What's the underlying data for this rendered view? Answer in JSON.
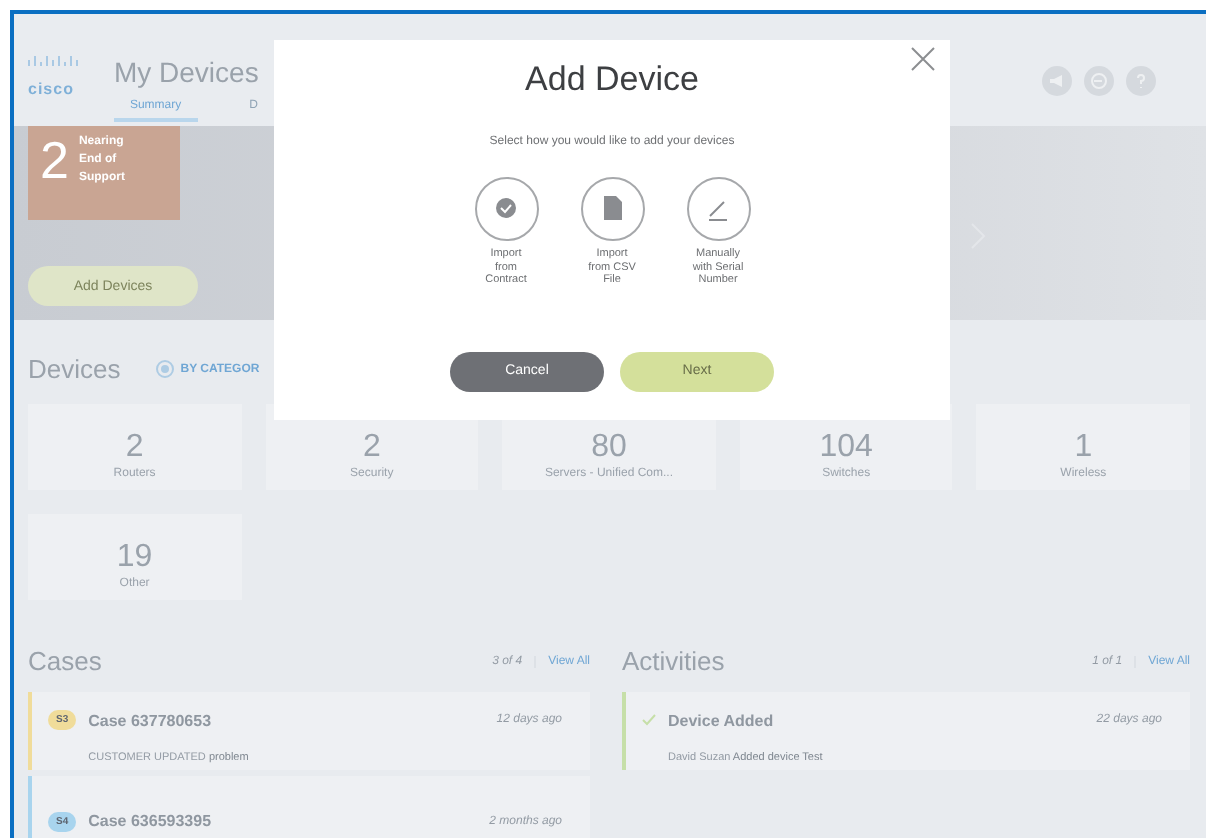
{
  "header": {
    "logo": "cisco",
    "title": "My Devices",
    "tabs": [
      {
        "label": "Summary",
        "selected": true
      },
      {
        "label": "D",
        "selected": false
      }
    ]
  },
  "hero": {
    "alert": {
      "count": "2",
      "label": "Nearing End of Support"
    },
    "button": "Add Devices"
  },
  "devices": {
    "title": "Devices",
    "filter": {
      "label": "BY CATEGOR",
      "selected": true
    },
    "categories": [
      {
        "count": "2",
        "label": "Routers"
      },
      {
        "count": "2",
        "label": "Security"
      },
      {
        "count": "80",
        "label": "Servers - Unified Com..."
      },
      {
        "count": "104",
        "label": "Switches"
      },
      {
        "count": "1",
        "label": "Wireless"
      },
      {
        "count": "19",
        "label": "Other"
      }
    ]
  },
  "cases": {
    "title": "Cases",
    "count": "3 of 4",
    "view_all": "View All",
    "items": [
      {
        "badge": "S3",
        "color": "#f0dc9a",
        "title": "Case 637780653",
        "time": "12 days ago",
        "status": "CUSTOMER UPDATED",
        "note": "problem"
      },
      {
        "badge": "S4",
        "color": "#a8d4ee",
        "title": "Case 636593395",
        "time": "2 months ago"
      }
    ]
  },
  "activities": {
    "title": "Activities",
    "count": "1 of 1",
    "view_all": "View All",
    "items": [
      {
        "color": "#c6dfa8",
        "title": "Device Added",
        "time": "22 days ago",
        "status": "David Suzan",
        "note": "Added device Test"
      }
    ]
  },
  "modal": {
    "title": "Add Device",
    "subtitle": "Select how you would like to add your devices",
    "options": [
      {
        "kind": "contract",
        "label": "Import\nfrom\nContract"
      },
      {
        "kind": "csv",
        "label": "Import\nfrom CSV\nFile"
      },
      {
        "kind": "manual",
        "label": "Manually\nwith Serial\nNumber"
      }
    ],
    "cancel": "Cancel",
    "next": "Next"
  }
}
